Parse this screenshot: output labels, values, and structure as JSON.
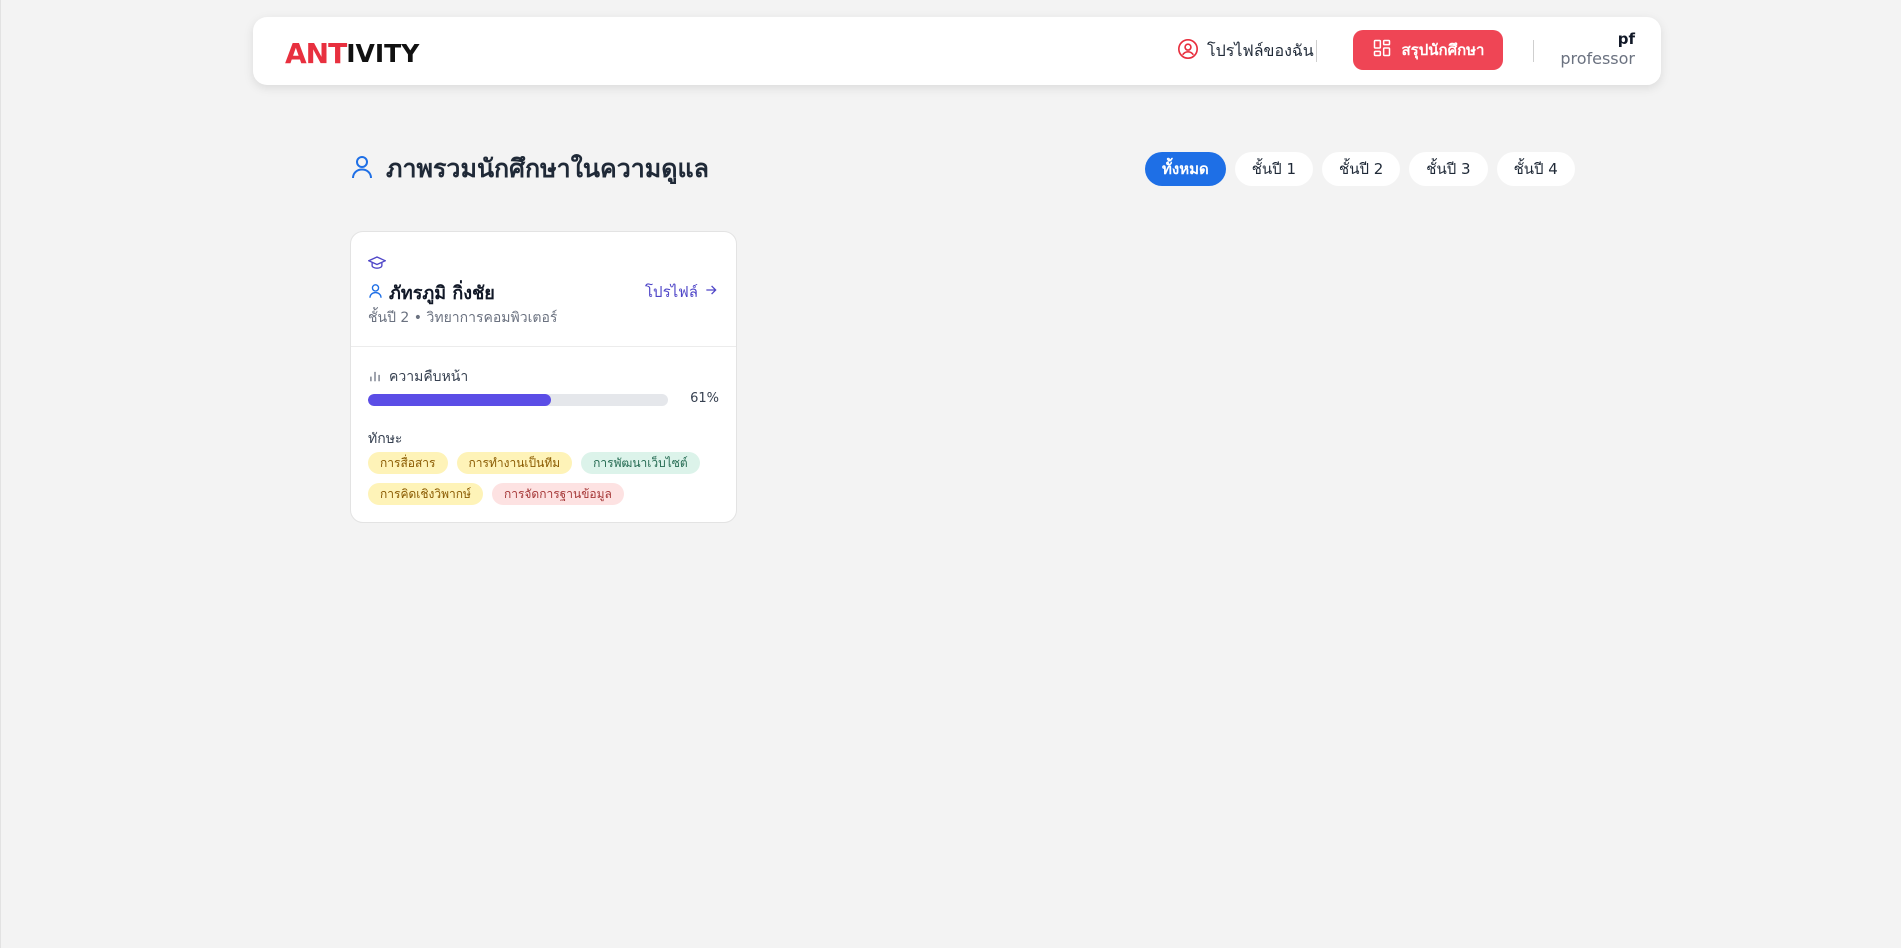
{
  "header": {
    "logo_part1": "ANT",
    "logo_part2": "IVITY",
    "profile_link": "โปรไฟล์ของฉัน",
    "summary_button": "สรุปนักศึกษา",
    "user_name": "pf",
    "user_role": "professor"
  },
  "page": {
    "title": "ภาพรวมนักศึกษาในความดูแล"
  },
  "filters": [
    {
      "label": "ทั้งหมด",
      "active": true
    },
    {
      "label": "ชั้นปี 1",
      "active": false
    },
    {
      "label": "ชั้นปี 2",
      "active": false
    },
    {
      "label": "ชั้นปี 3",
      "active": false
    },
    {
      "label": "ชั้นปี 4",
      "active": false
    }
  ],
  "students": [
    {
      "name": "ภัทรภูมิ กิ่งชัย",
      "subtitle": "ชั้นปี 2 • วิทยาการคอมพิวเตอร์",
      "profile_link": "โปรไฟล์",
      "progress_label": "ความคืบหน้า",
      "progress_percent": 61,
      "progress_text": "61%",
      "skills_label": "ทักษะ",
      "skills": [
        {
          "label": "การสื่อสาร",
          "color": "yellow"
        },
        {
          "label": "การทำงานเป็นทีม",
          "color": "yellow"
        },
        {
          "label": "การพัฒนาเว็บไซต์",
          "color": "green"
        },
        {
          "label": "การคิดเชิงวิพากษ์",
          "color": "yellow"
        },
        {
          "label": "การจัดการฐานข้อมูล",
          "color": "red"
        }
      ]
    }
  ],
  "colors": {
    "brand_red": "#ef4555",
    "active_blue": "#1e6fe6",
    "progress": "#5b4de6",
    "link": "#4f46c8"
  }
}
